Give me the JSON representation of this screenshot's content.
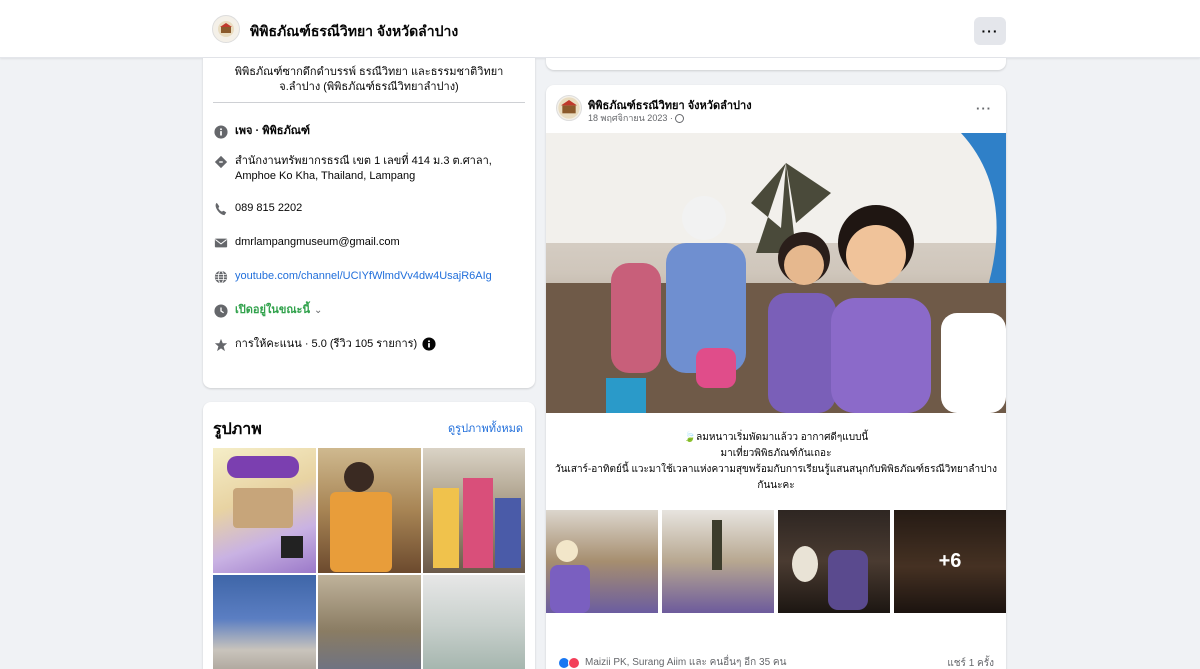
{
  "page": {
    "name": "พิพิธภัณฑ์ธรณีวิทยา จังหวัดลำปาง",
    "more_label": "···"
  },
  "intro": {
    "bio": "พิพิธภัณฑ์ซากดึกดำบรรพ์ ธรณีวิทยา และธรรมชาติวิทยา จ.ลำปาง (พิพิธภัณฑ์ธรณีวิทยาลำปาง)",
    "category": "เพจ · พิพิธภัณฑ์",
    "address": "สำนักงานทรัพยากรธรณี เขต 1 เลขที่ 414 ม.3 ต.ศาลา, Amphoe Ko Kha, Thailand, Lampang",
    "phone": "089 815 2202",
    "email": "dmrlampangmuseum@gmail.com",
    "website": "youtube.com/channel/UCIYfWlmdVv4dw4UsajR6AIg",
    "hours": "เปิดอยู่ในขณะนี้",
    "rating": "การให้คะแนน · 5.0 (รีวิว 105 รายการ)"
  },
  "photos": {
    "title": "รูปภาพ",
    "see_all": "ดูรูปภาพทั้งหมด"
  },
  "post": {
    "author": "พิพิธภัณฑ์ธรณีวิทยา จังหวัดลำปาง",
    "date": "18 พฤศจิกายน 2023 · ",
    "more_label": "···",
    "text_line1": "🍃ลมหนาวเริ่มพัดมาแล้วว อากาศดีๆแบบนี้",
    "text_line2": "มาเที่ยวพิพิธภัณฑ์กันเถอะ",
    "text_line3": "วันเสาร์-อาทิตย์นี้ แวะมาใช้เวลาแห่งความสุขพร้อมกับการเรียนรู้แสนสนุกกับพิพิธภัณฑ์ธรณีวิทยาลำปางกันนะคะ",
    "extra_photos": "+6",
    "reactions_text": "Maizii PK, Surang Aiim และ คนอื่นๆ อีก 35 คน",
    "shares_text": "แชร์ 1 ครั้ง"
  },
  "colors": {
    "link": "#216fdb",
    "open_green": "#31a24c",
    "like_blue": "#1877f2",
    "love_red": "#f33e58"
  }
}
